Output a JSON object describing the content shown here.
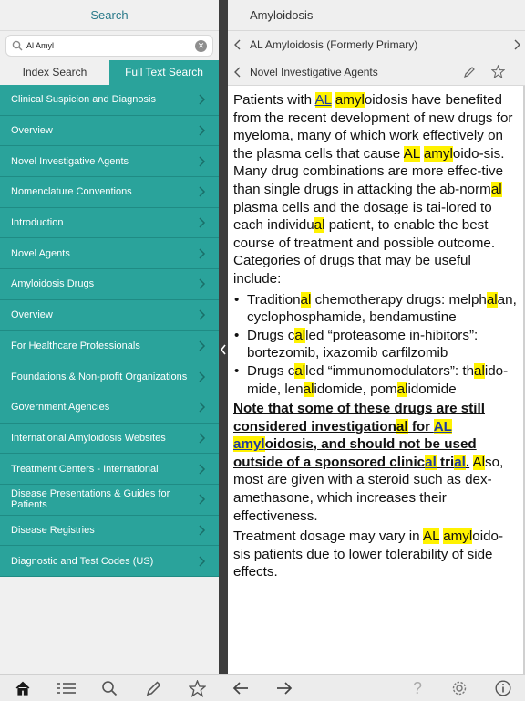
{
  "left": {
    "title": "Search",
    "search": {
      "value": "Al Amyl",
      "placeholder": ""
    },
    "segments": {
      "index": "Index Search",
      "fulltext": "Full Text Search"
    },
    "items": [
      "Clinical Suspicion and Diagnosis",
      "Overview",
      "Novel Investigative Agents",
      "Nomenclature Conventions",
      "Introduction",
      "Novel Agents",
      "Amyloidosis Drugs",
      "Overview",
      "For Healthcare Professionals",
      "Foundations & Non-profit Organizations",
      "Government Agencies",
      "International Amyloidosis Websites",
      "Treatment Centers - International",
      "Disease Presentations & Guides for Patients",
      "Disease Registries",
      "Diagnostic and Test Codes (US)"
    ]
  },
  "right": {
    "title": "Amyloidosis",
    "crumb1": "AL Amyloidosis (Formerly Primary)",
    "crumb2": "Novel Investigative Agents",
    "doc": {
      "p1": [
        {
          "t": "Patients with "
        },
        {
          "t": "AL",
          "h": "hl-u"
        },
        {
          "t": " "
        },
        {
          "t": "amyl",
          "h": "hl"
        },
        {
          "t": "oidosis have benefited from the recent development of new drugs for myeloma, many of which work effectively on the plasma cells that cause "
        },
        {
          "t": "AL",
          "h": "hl"
        },
        {
          "t": " "
        },
        {
          "t": "amyl",
          "h": "hl"
        },
        {
          "t": "oido-sis. Many drug combinations are more effec-tive than single drugs in attacking the ab-norm"
        },
        {
          "t": "al",
          "h": "hl"
        },
        {
          "t": " plasma cells and the dosage is tai-lored to each individu"
        },
        {
          "t": "al",
          "h": "hl"
        },
        {
          "t": " patient, to enable the best course of treatment and possible outcome. Categories of drugs that may be useful include:"
        }
      ],
      "bullets": [
        [
          {
            "t": "Tradition"
          },
          {
            "t": "al",
            "h": "hl"
          },
          {
            "t": " chemotherapy drugs: melph"
          },
          {
            "t": "al",
            "h": "hl"
          },
          {
            "t": "an, cyclophosphamide, bendamustine"
          }
        ],
        [
          {
            "t": "Drugs c"
          },
          {
            "t": "al",
            "h": "hl"
          },
          {
            "t": "led “proteasome in-hibitors”: bortezomib, ixazomib carfilzomib"
          }
        ],
        [
          {
            "t": "Drugs c"
          },
          {
            "t": "al",
            "h": "hl"
          },
          {
            "t": "led “immunomodulators”: th"
          },
          {
            "t": "al",
            "h": "hl"
          },
          {
            "t": "ido-mide, len"
          },
          {
            "t": "al",
            "h": "hl"
          },
          {
            "t": "idomide, pom"
          },
          {
            "t": "al",
            "h": "hl"
          },
          {
            "t": "idomide"
          }
        ]
      ],
      "p2": [
        {
          "t": "Note that some of these drugs are still considered investigation",
          "c": "note"
        },
        {
          "t": "al",
          "h": "hl",
          "c": "note"
        },
        {
          "t": " for ",
          "c": "note"
        },
        {
          "t": "AL",
          "h": "hl-u",
          "c": "note"
        },
        {
          "t": " ",
          "c": "note"
        },
        {
          "t": "amyl",
          "h": "hl-u",
          "c": "note"
        },
        {
          "t": "oidosis, and should not be used outside of a sponsored clinic",
          "c": "note"
        },
        {
          "t": "al",
          "h": "hl-u",
          "c": "note"
        },
        {
          "t": " tri",
          "c": "note"
        },
        {
          "t": "al",
          "h": "hl-u",
          "c": "note"
        },
        {
          "t": ".",
          "c": "note"
        },
        {
          "t": " "
        },
        {
          "t": "Al",
          "h": "hl"
        },
        {
          "t": "so, most are given with a steroid such as dex-amethasone, which increases their effectiveness."
        }
      ],
      "p3": [
        {
          "t": "Treatment dosage may vary in "
        },
        {
          "t": "AL",
          "h": "hl"
        },
        {
          "t": " "
        },
        {
          "t": "amyl",
          "h": "hl"
        },
        {
          "t": "oido-sis patients due to lower tolerability of side effects."
        }
      ]
    }
  },
  "toolbar": {
    "icons": [
      "home-icon",
      "list-icon",
      "search-icon",
      "pencil-icon",
      "star-icon",
      "arrow-left-icon",
      "arrow-right-icon",
      "help-icon",
      "settings-icon",
      "info-icon"
    ]
  },
  "colors": {
    "accent": "#2aa39b",
    "highlight": "#fff200",
    "title": "#2a7a8a"
  }
}
